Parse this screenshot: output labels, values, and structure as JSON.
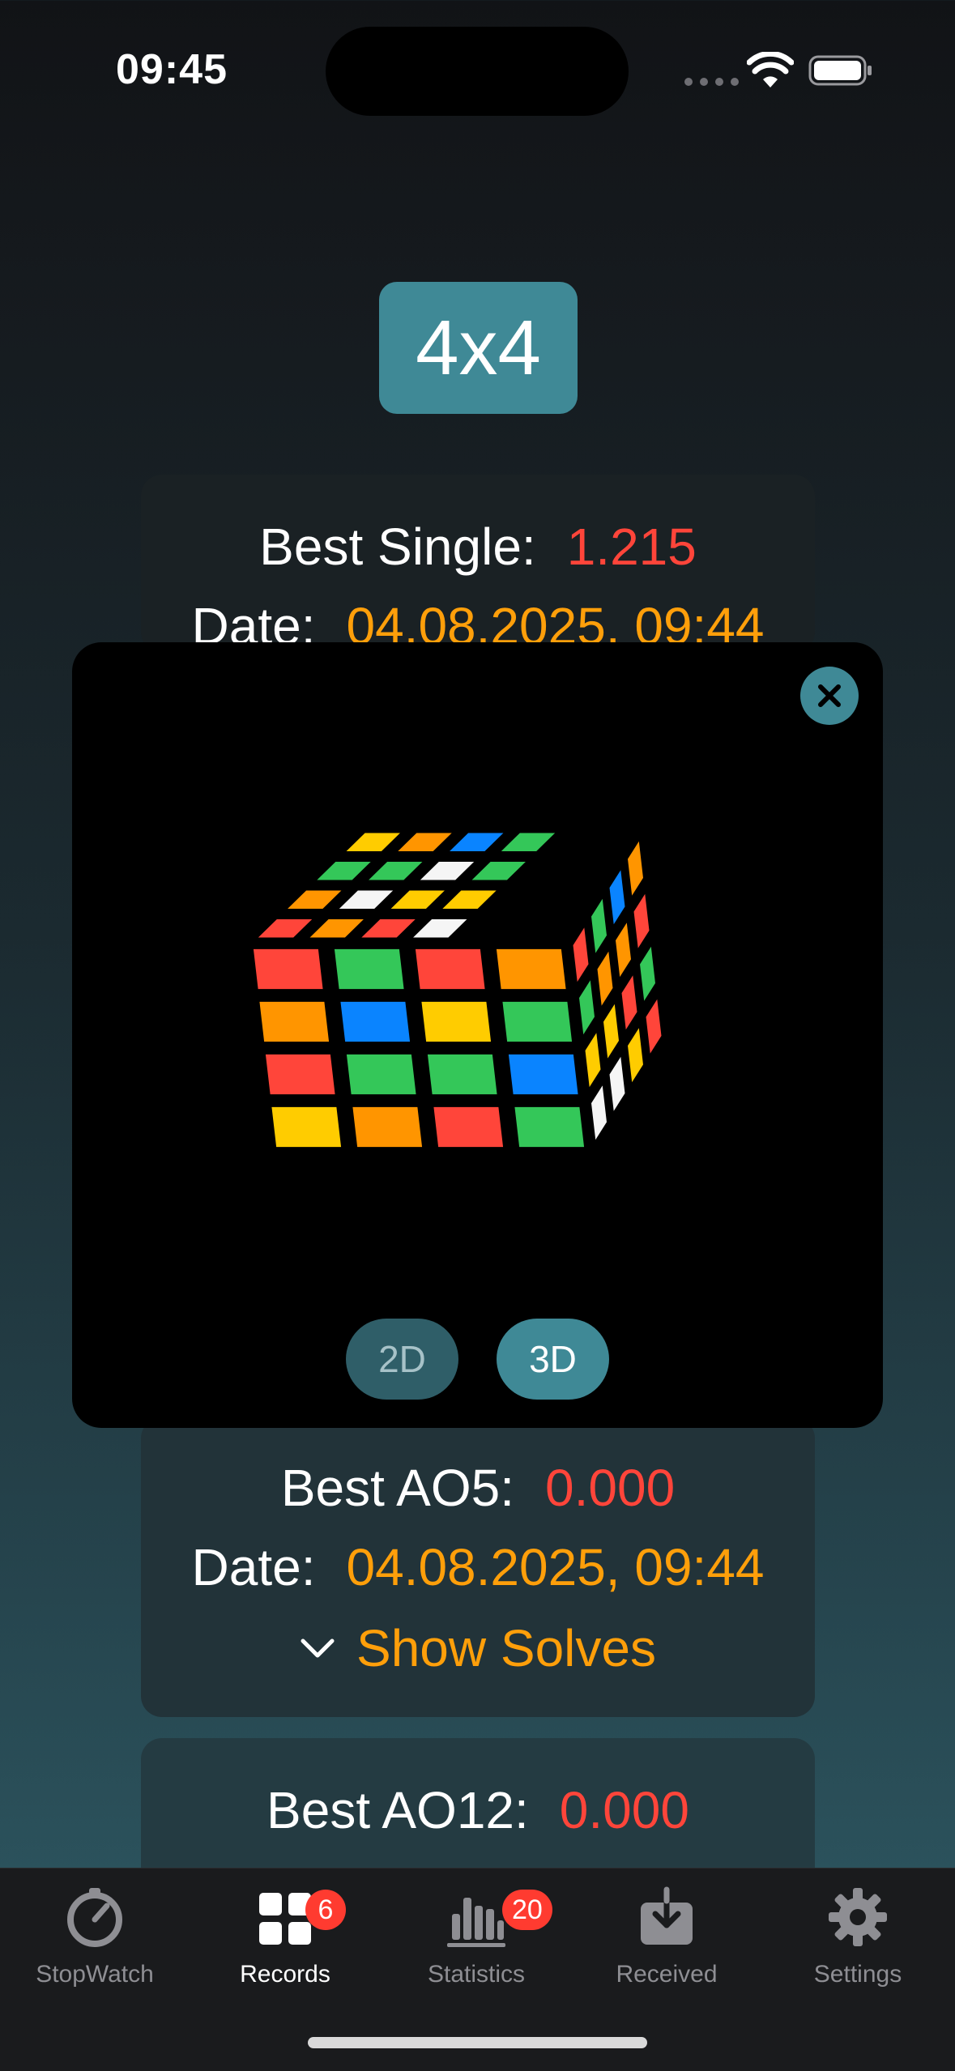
{
  "status": {
    "time": "09:45"
  },
  "puzzle": {
    "label": "4x4"
  },
  "best_single": {
    "label": "Best Single:",
    "value": "1.215",
    "date_label": "Date:",
    "date": "04.08.2025, 09:44"
  },
  "best_ao5": {
    "label": "Best AO5:",
    "value": "0.000",
    "date_label": "Date:",
    "date": "04.08.2025, 09:44",
    "show_solves": "Show Solves"
  },
  "best_ao12": {
    "label": "Best AO12:",
    "value": "0.000"
  },
  "modal": {
    "mode_2d": "2D",
    "mode_3d": "3D",
    "selected_mode": "3D"
  },
  "tabs": [
    {
      "label": "StopWatch",
      "icon": "stopwatch-icon"
    },
    {
      "label": "Records",
      "icon": "grid-icon",
      "badge": "6"
    },
    {
      "label": "Statistics",
      "icon": "bar-chart-icon",
      "badge": "20"
    },
    {
      "label": "Received",
      "icon": "tray-download-icon"
    },
    {
      "label": "Settings",
      "icon": "gear-icon"
    }
  ],
  "colors": {
    "accent": "#3f8996",
    "red": "#ff453a",
    "orange": "#ff9f0a",
    "badge": "#ff3b30"
  }
}
